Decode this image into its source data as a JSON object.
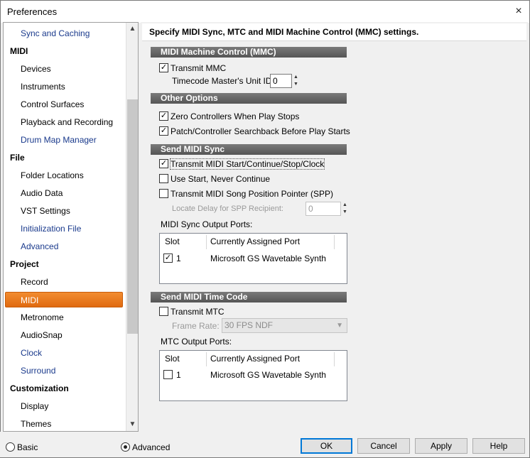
{
  "window": {
    "title": "Preferences",
    "close_glyph": "×"
  },
  "sidebar": {
    "items": [
      {
        "label": "Sync and Caching",
        "kind": "link"
      },
      {
        "label": "MIDI",
        "kind": "cat"
      },
      {
        "label": "Devices",
        "kind": "sub"
      },
      {
        "label": "Instruments",
        "kind": "sub"
      },
      {
        "label": "Control Surfaces",
        "kind": "sub"
      },
      {
        "label": "Playback and Recording",
        "kind": "sub"
      },
      {
        "label": "Drum Map Manager",
        "kind": "link"
      },
      {
        "label": "File",
        "kind": "cat"
      },
      {
        "label": "Folder Locations",
        "kind": "sub"
      },
      {
        "label": "Audio Data",
        "kind": "sub"
      },
      {
        "label": "VST Settings",
        "kind": "sub"
      },
      {
        "label": "Initialization File",
        "kind": "link"
      },
      {
        "label": "Advanced",
        "kind": "link"
      },
      {
        "label": "Project",
        "kind": "cat"
      },
      {
        "label": "Record",
        "kind": "sub"
      },
      {
        "label": "MIDI",
        "kind": "selected"
      },
      {
        "label": "Metronome",
        "kind": "sub"
      },
      {
        "label": "AudioSnap",
        "kind": "sub"
      },
      {
        "label": "Clock",
        "kind": "link"
      },
      {
        "label": "Surround",
        "kind": "link"
      },
      {
        "label": "Customization",
        "kind": "cat"
      },
      {
        "label": "Display",
        "kind": "sub"
      },
      {
        "label": "Themes",
        "kind": "sub"
      }
    ],
    "selected_color": "#e87820",
    "link_color": "#1a3a8c"
  },
  "header": {
    "text": "Specify MIDI Sync, MTC and MIDI Machine Control (MMC) settings."
  },
  "mmc": {
    "title": "MIDI Machine Control (MMC)",
    "transmit_mmc": {
      "label": "Transmit MMC",
      "checked": true
    },
    "unit_id_label": "Timecode Master's Unit ID:",
    "unit_id_value": "0"
  },
  "other": {
    "title": "Other Options",
    "zero_controllers": {
      "label": "Zero Controllers When Play Stops",
      "checked": true
    },
    "patch_searchback": {
      "label": "Patch/Controller Searchback Before Play Starts",
      "checked": true
    }
  },
  "sync": {
    "title": "Send MIDI Sync",
    "transmit_start": {
      "label": "Transmit MIDI Start/Continue/Stop/Clock",
      "checked": true
    },
    "use_start": {
      "label": "Use Start, Never Continue",
      "checked": false
    },
    "transmit_spp": {
      "label": "Transmit MIDI Song Position Pointer (SPP)",
      "checked": false
    },
    "locate_delay_label": "Locate Delay for SPP Recipient:",
    "locate_delay_value": "0",
    "ports_label": "MIDI Sync Output Ports:",
    "columns": [
      "Slot",
      "Currently Assigned Port"
    ],
    "rows": [
      {
        "slot": "1",
        "port": "Microsoft GS Wavetable Synth",
        "checked": true
      }
    ]
  },
  "mtc": {
    "title": "Send MIDI Time Code",
    "transmit_mtc": {
      "label": "Transmit MTC",
      "checked": false
    },
    "frame_rate_label": "Frame Rate:",
    "frame_rate_value": "30 FPS NDF",
    "ports_label": "MTC Output Ports:",
    "columns": [
      "Slot",
      "Currently Assigned Port"
    ],
    "rows": [
      {
        "slot": "1",
        "port": "Microsoft GS Wavetable Synth",
        "checked": false
      }
    ]
  },
  "footer": {
    "basic_label": "Basic",
    "advanced_label": "Advanced",
    "mode": "advanced",
    "ok_label": "OK",
    "cancel_label": "Cancel",
    "apply_label": "Apply",
    "help_label": "Help"
  }
}
